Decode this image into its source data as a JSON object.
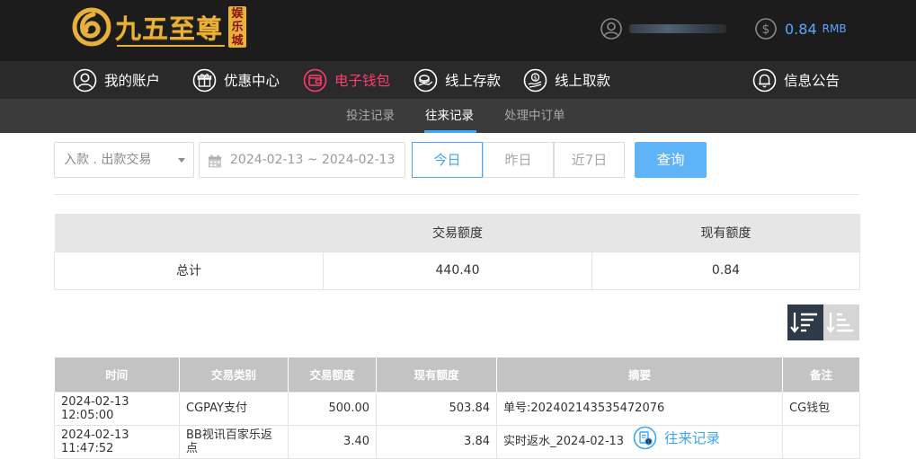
{
  "brand": {
    "name": "九五至尊",
    "badge": "娱乐城"
  },
  "user": {
    "balance": "0.84",
    "currency": "RMB"
  },
  "nav": {
    "items": [
      {
        "label": "我的账户",
        "icon": "user-circle-icon"
      },
      {
        "label": "优惠中心",
        "icon": "gift-icon"
      },
      {
        "label": "电子钱包",
        "icon": "wallet-icon"
      },
      {
        "label": "线上存款",
        "icon": "deposit-icon"
      },
      {
        "label": "线上取款",
        "icon": "withdraw-icon"
      },
      {
        "label": "往来记录",
        "icon": "record-icon"
      },
      {
        "label": "信息公告",
        "icon": "bell-icon"
      }
    ],
    "active_color": "#3ea6f7",
    "wallet_color": "#ff3c6e"
  },
  "subnav": {
    "items": [
      "投注记录",
      "往来记录",
      "处理中订单"
    ],
    "active": "往来记录"
  },
  "filters": {
    "type_value": "入款 . 出款交易",
    "date_range": "2024-02-13 ~ 2024-02-13",
    "days": [
      "今日",
      "昨日",
      "近7日"
    ],
    "active_day": "今日",
    "query_label": "查询"
  },
  "summary": {
    "headers": [
      "",
      "交易额度",
      "现有额度"
    ],
    "row": [
      "总计",
      "440.40",
      "0.84"
    ]
  },
  "records": {
    "headers": [
      "时间",
      "交易类别",
      "交易额度",
      "现有额度",
      "摘要",
      "备注"
    ],
    "rows": [
      [
        "2024-02-13 12:05:00",
        "CGPAY支付",
        "500.00",
        "503.84",
        "单号:202402143535472076",
        "CG钱包"
      ],
      [
        "2024-02-13 11:47:52",
        "BB视讯百家乐返点",
        "3.40",
        "3.84",
        "实时返水_2024-02-13",
        ""
      ]
    ]
  }
}
